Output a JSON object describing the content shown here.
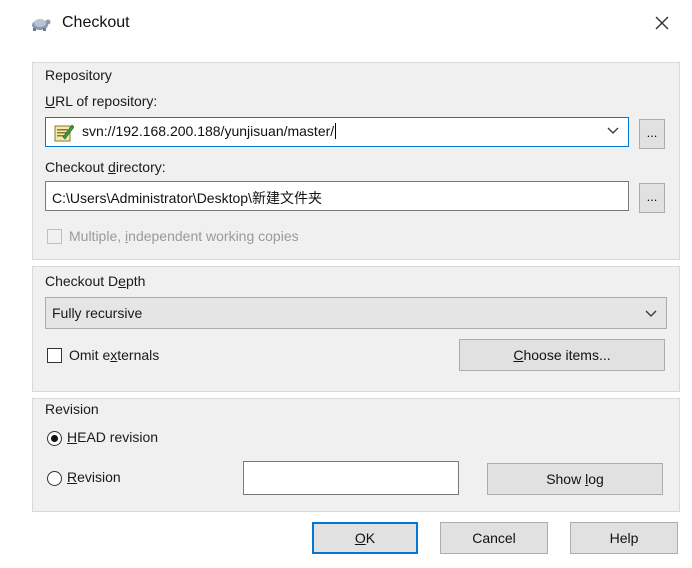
{
  "window": {
    "title": "Checkout",
    "close_glyph": "✕"
  },
  "repository": {
    "group_label": "Repository",
    "url_label": "URL of repository:",
    "url_value": "svn://192.168.200.188/yunjisuan/master/",
    "browse_label": "...",
    "dir_label": "Checkout directory:",
    "dir_value": "C:\\Users\\Administrator\\Desktop\\新建文件夹",
    "browse_dir_label": "...",
    "multiple_label": "Multiple, independent working copies",
    "multiple_checked": false
  },
  "depth": {
    "group_label": "Checkout Depth",
    "selected": "Fully recursive",
    "omit_label": "Omit externals",
    "omit_checked": false,
    "choose_label": "Choose items..."
  },
  "revision": {
    "group_label": "Revision",
    "head_label": "HEAD revision",
    "head_selected": true,
    "rev_label": "Revision",
    "rev_value": "",
    "show_log_label": "Show log"
  },
  "buttons": {
    "ok": "OK",
    "cancel": "Cancel",
    "help": "Help"
  },
  "icons": {
    "title": "tortoise-svn-icon",
    "url_field": "svn-repo-edit-icon",
    "combo_caret": "chevron-down-icon"
  },
  "colors": {
    "focus": "#0078d7",
    "button_face": "#e1e1e1",
    "group_bg": "#f0f0f0"
  }
}
